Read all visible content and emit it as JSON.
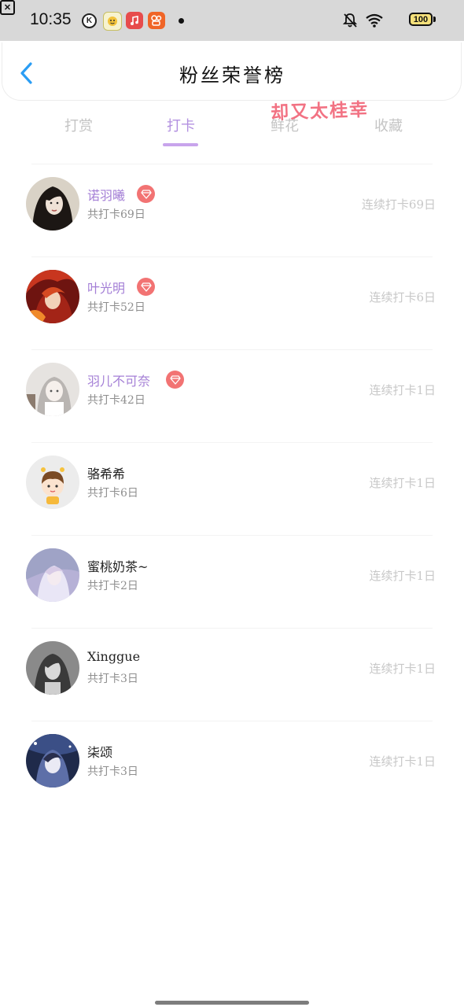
{
  "status_bar": {
    "time": "10:35",
    "k_icon": "K",
    "battery": "100",
    "icons": [
      "k-app-icon",
      "face-app-icon",
      "music-app-icon",
      "kuaishou-app-icon",
      "dot-icon",
      "bell-off-icon",
      "wifi-icon",
      "x-box-icon",
      "battery-icon"
    ]
  },
  "header": {
    "title": "粉丝荣誉榜",
    "back_icon": "chevron-left-icon",
    "accent_color": "#2a9df4"
  },
  "tabs": [
    {
      "label": "打赏",
      "active": false
    },
    {
      "label": "打卡",
      "active": true
    },
    {
      "label": "鲜花",
      "active": false
    },
    {
      "label": "收藏",
      "active": false
    }
  ],
  "watermark": "却又太桂幸",
  "colors": {
    "active_tab": "#b391e0",
    "vip_name": "#a47fd6",
    "badge": "#f27373"
  },
  "fans": [
    {
      "name": "诺羽曦",
      "total": "共打卡69日",
      "streak": "连续打卡69日",
      "vip": true
    },
    {
      "name": "叶光明",
      "total": "共打卡52日",
      "streak": "连续打卡6日",
      "vip": true
    },
    {
      "name": "羽儿不可奈",
      "total": "共打卡42日",
      "streak": "连续打卡1日",
      "vip": true
    },
    {
      "name": "骆希希",
      "total": "共打卡6日",
      "streak": "连续打卡1日",
      "vip": false
    },
    {
      "name": "蜜桃奶茶~",
      "total": "共打卡2日",
      "streak": "连续打卡1日",
      "vip": false
    },
    {
      "name": "Xinggue",
      "total": "共打卡3日",
      "streak": "连续打卡1日",
      "vip": false
    },
    {
      "name": "柒颂",
      "total": "共打卡3日",
      "streak": "连续打卡1日",
      "vip": false
    }
  ]
}
